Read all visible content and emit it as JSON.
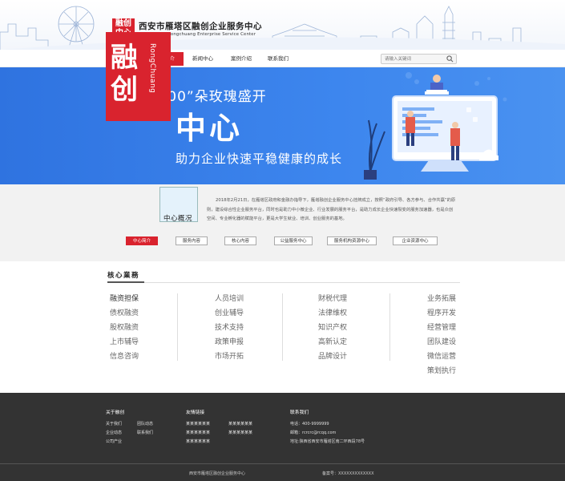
{
  "header": {
    "logo_line1": "融创",
    "logo_line2": "中心",
    "site_name": "西安市雁塔区融创企业服务中心",
    "site_name_en": "Xi 'an Yanta Rongchuang Enterprise Service Center"
  },
  "nav": {
    "items": [
      "首页",
      "中心简介",
      "新闻中心",
      "案例介绍",
      "联系我们"
    ],
    "active": "中心简介",
    "search_placeholder": "请输入关键词"
  },
  "banner": {
    "slogan": "愿“10000”朵玫瑰盛开",
    "box_line1": "融",
    "box_line2": "创",
    "box_vertical": "RongChuang",
    "center": "中心",
    "sub": "助力企业快速平稳健康的成长"
  },
  "intro": {
    "thumb_label": "中心概况",
    "text": "2018年2月21日，在雁塔区政府和金融办指导下，雁塔融创企业服务中心挂牌成立，按照“政府引导、各方参与、合作共赢”的原则，建设综合性企业服务平台，同时也是助力中小微企业、行业发展的服务平台，是助力成长企业快速裂变的服务加速器，也是众创空间、专业孵化器的赋能平台，更是大学生就业、培训、创业服务的基地。",
    "tabs": [
      "中心简介",
      "服务内容",
      "核心内容",
      "公益服务中心",
      "服务机构资源中心",
      "企业资源中心"
    ],
    "active_tab": "中心简介"
  },
  "core": {
    "title": "核心業務",
    "columns": [
      [
        "融资担保",
        "债权融资",
        "股权融资",
        "上市辅导",
        "信息咨询"
      ],
      [
        "人员培训",
        "创业辅导",
        "技术支持",
        "政策申报",
        "市场开拓"
      ],
      [
        "财税代理",
        "法律维权",
        "知识产权",
        "高新认定",
        "品牌设计"
      ],
      [
        "业务拓展",
        "程序开发",
        "经营管理",
        "团队建设",
        "微信运营",
        "策划执行"
      ]
    ]
  },
  "footer": {
    "about": {
      "title": "关于融创",
      "links": [
        "关于我们",
        "团队动态",
        "企业动态",
        "联系我们",
        "公司产业"
      ]
    },
    "friends": {
      "title": "友情链接",
      "links": [
        "某某某某某某",
        "某某某某某某",
        "某某某某某某",
        "某某某某某某",
        "某某某某某某"
      ]
    },
    "contact": {
      "title": "联系我们",
      "phone": "电话：400-9999999",
      "email": "邮箱：rcrcrc@rcqq.com",
      "address": "地址:陕西省西安市雁塔区南二环西段78号"
    },
    "copyright": "西安市雁塔区融创企业服务中心",
    "icp": "备案号：XXXXXXXXXXXXX"
  },
  "colors": {
    "brand_red": "#d9232e",
    "banner_blue": "#2f73e0",
    "footer_bg": "#333333"
  }
}
